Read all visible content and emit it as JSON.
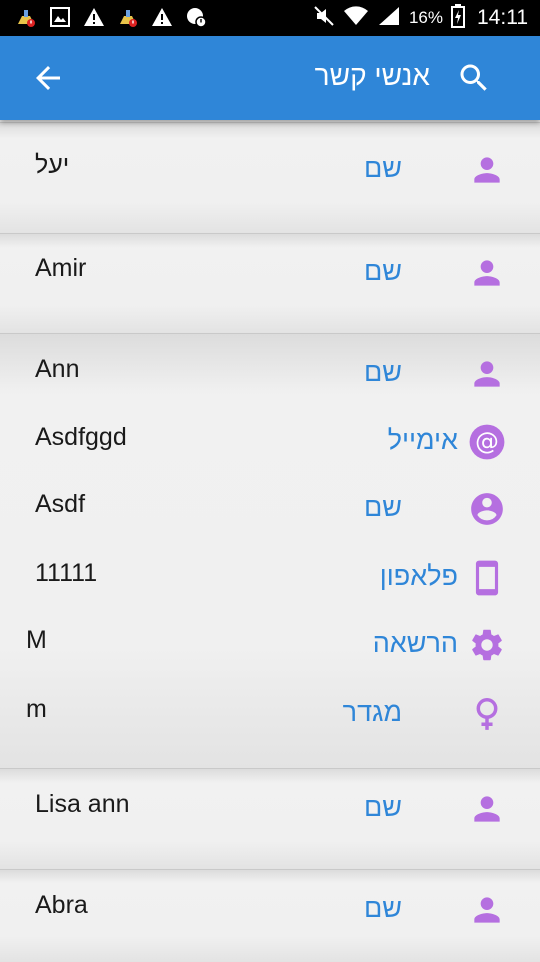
{
  "status_bar": {
    "battery": "16%",
    "time": "14:11",
    "left_icons": [
      "cleaner-alert-icon",
      "image-icon",
      "warning-icon",
      "cleaner-alert-icon",
      "warning-icon",
      "update-alert-icon"
    ],
    "right_icons": [
      "mute-icon",
      "wifi-icon",
      "signal-icon",
      "battery-charging-icon"
    ]
  },
  "header": {
    "title": "אנשי קשר",
    "back_icon": "arrow-back-icon",
    "search_icon": "search-icon"
  },
  "colors": {
    "primary": "#2f86d8",
    "icon": "#b56fe0",
    "text": "#1a1a1a"
  },
  "contacts": [
    {
      "fields": [
        {
          "label": "שם",
          "value": "יעל",
          "icon": "person-icon"
        }
      ]
    },
    {
      "fields": [
        {
          "label": "שם",
          "value": "Amir",
          "icon": "person-icon"
        }
      ]
    },
    {
      "fields": [
        {
          "label": "שם",
          "value": "Ann",
          "icon": "person-icon"
        },
        {
          "label": "אימייל",
          "value": "Asdfggd",
          "icon": "at-icon"
        },
        {
          "label": "שם",
          "value": "Asdf",
          "icon": "account-circle-icon"
        },
        {
          "label": "פלאפון",
          "value": "11111",
          "icon": "smartphone-icon"
        },
        {
          "label": "הרשאה",
          "value": "M",
          "icon": "gear-icon"
        },
        {
          "label": "מגדר",
          "value": "m",
          "icon": "female-icon"
        }
      ]
    },
    {
      "fields": [
        {
          "label": "שם",
          "value": "Lisa ann",
          "icon": "person-icon"
        }
      ]
    },
    {
      "fields": [
        {
          "label": "שם",
          "value": "Abra",
          "icon": "person-icon"
        }
      ]
    }
  ]
}
